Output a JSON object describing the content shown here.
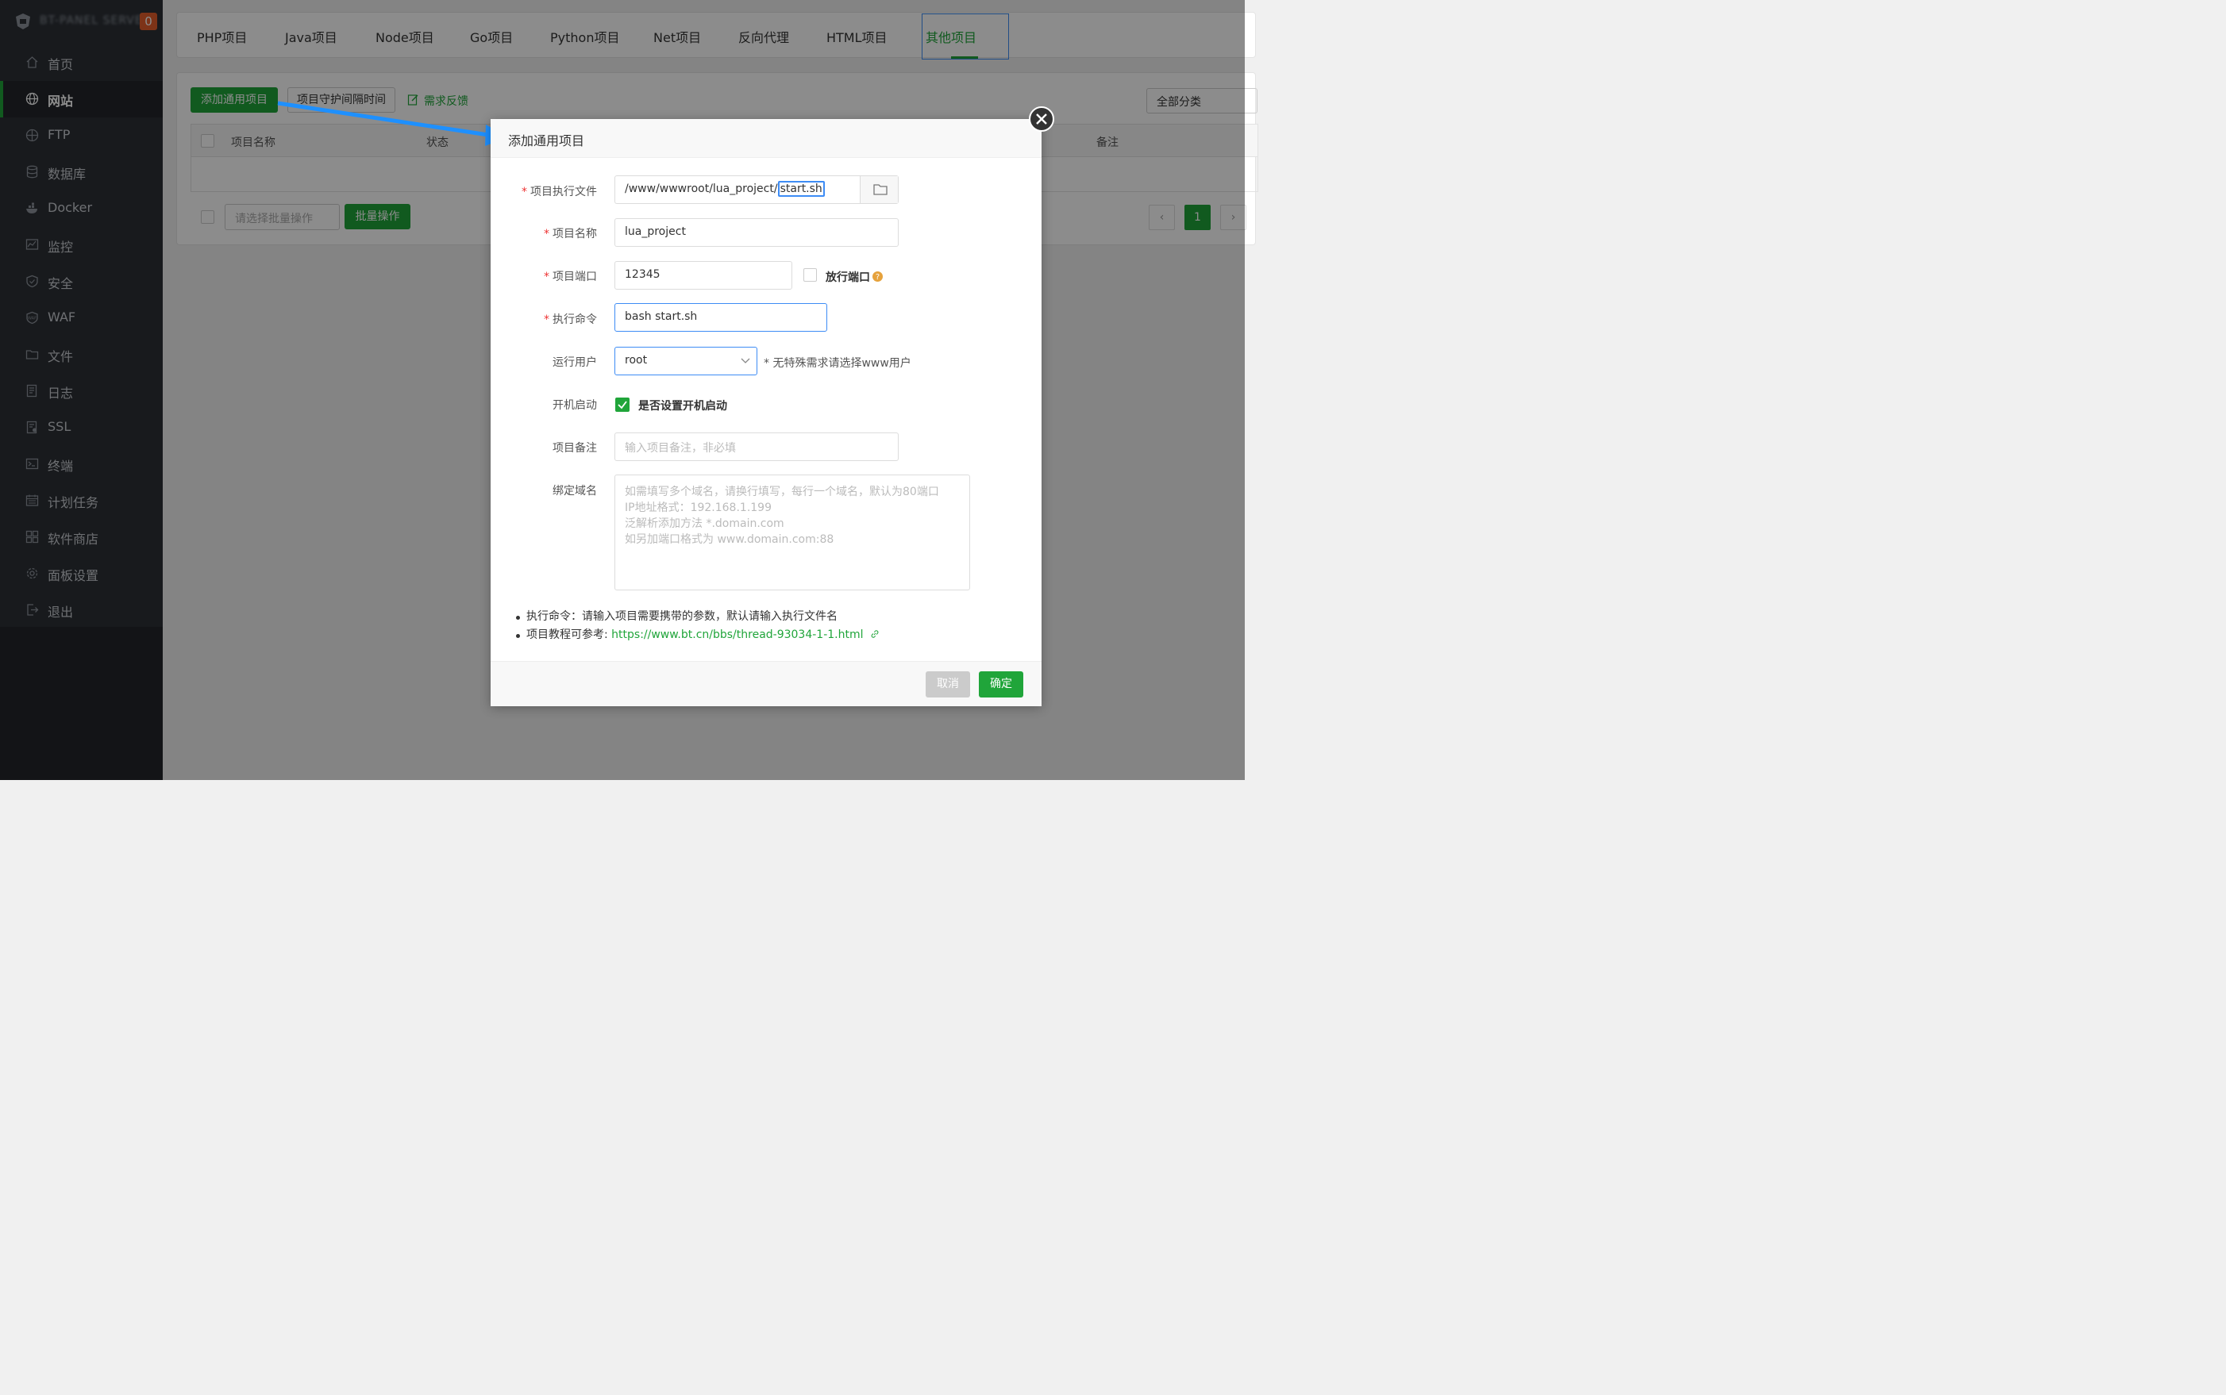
{
  "sidebar": {
    "brand_name": "BT-PANEL SERVER",
    "badge_count": "0",
    "items": [
      {
        "label": "首页",
        "icon": "home-icon"
      },
      {
        "label": "网站",
        "icon": "globe-icon"
      },
      {
        "label": "FTP",
        "icon": "ftp-icon"
      },
      {
        "label": "数据库",
        "icon": "database-icon"
      },
      {
        "label": "Docker",
        "icon": "docker-icon"
      },
      {
        "label": "监控",
        "icon": "monitor-icon"
      },
      {
        "label": "安全",
        "icon": "shield-icon"
      },
      {
        "label": "WAF",
        "icon": "waf-icon"
      },
      {
        "label": "文件",
        "icon": "folder-icon"
      },
      {
        "label": "日志",
        "icon": "log-icon"
      },
      {
        "label": "SSL",
        "icon": "ssl-icon"
      },
      {
        "label": "终端",
        "icon": "terminal-icon"
      },
      {
        "label": "计划任务",
        "icon": "calendar-icon"
      },
      {
        "label": "软件商店",
        "icon": "apps-icon"
      },
      {
        "label": "面板设置",
        "icon": "gear-icon"
      },
      {
        "label": "退出",
        "icon": "logout-icon"
      }
    ]
  },
  "tabs": [
    {
      "label": "PHP项目"
    },
    {
      "label": "Java项目"
    },
    {
      "label": "Node项目"
    },
    {
      "label": "Go项目"
    },
    {
      "label": "Python项目"
    },
    {
      "label": "Net项目"
    },
    {
      "label": "反向代理"
    },
    {
      "label": "HTML项目"
    },
    {
      "label": "其他项目"
    }
  ],
  "toolbar": {
    "add_button": "添加通用项目",
    "guard_button": "项目守护间隔时间",
    "feedback": "需求反馈",
    "category_select": "全部分类"
  },
  "table": {
    "headers": [
      "项目名称",
      "状态",
      "备注"
    ]
  },
  "batch": {
    "select_placeholder": "请选择批量操作",
    "button": "批量操作"
  },
  "pager": {
    "current": "1"
  },
  "dialog": {
    "title": "添加通用项目",
    "fields": {
      "exec_file": {
        "label": "项目执行文件",
        "value_prefix": "/www/wwwroot/lua_project/",
        "value_selected": "start.sh"
      },
      "name": {
        "label": "项目名称",
        "value": "lua_project"
      },
      "port": {
        "label": "项目端口",
        "value": "12345",
        "open_port_label": "放行端口"
      },
      "command": {
        "label": "执行命令",
        "value": "bash start.sh"
      },
      "user": {
        "label": "运行用户",
        "value": "root",
        "hint": "* 无特殊需求请选择www用户"
      },
      "autostart": {
        "label": "开机启动",
        "checkbox_label": "是否设置开机启动",
        "checked": true
      },
      "remark": {
        "label": "项目备注",
        "placeholder": "输入项目备注，非必填"
      },
      "domain": {
        "label": "绑定域名",
        "placeholder_lines": [
          "如需填写多个域名，请换行填写，每行一个域名，默认为80端口",
          "IP地址格式：192.168.1.199",
          "泛解析添加方法 *.domain.com",
          "如另加端口格式为 www.domain.com:88"
        ]
      }
    },
    "tips": {
      "command_tip": "执行命令：请输入项目需要携带的参数，默认请输入执行文件名",
      "tutorial_prefix": "项目教程可参考: ",
      "tutorial_link": "https://www.bt.cn/bbs/thread-93034-1-1.html"
    },
    "cancel": "取消",
    "confirm": "确定"
  },
  "colors": {
    "accent": "#20a53a",
    "sidebar_bg": "#2c3036",
    "arrow": "#1e90ff",
    "focus_blue": "#3d8cf5"
  }
}
